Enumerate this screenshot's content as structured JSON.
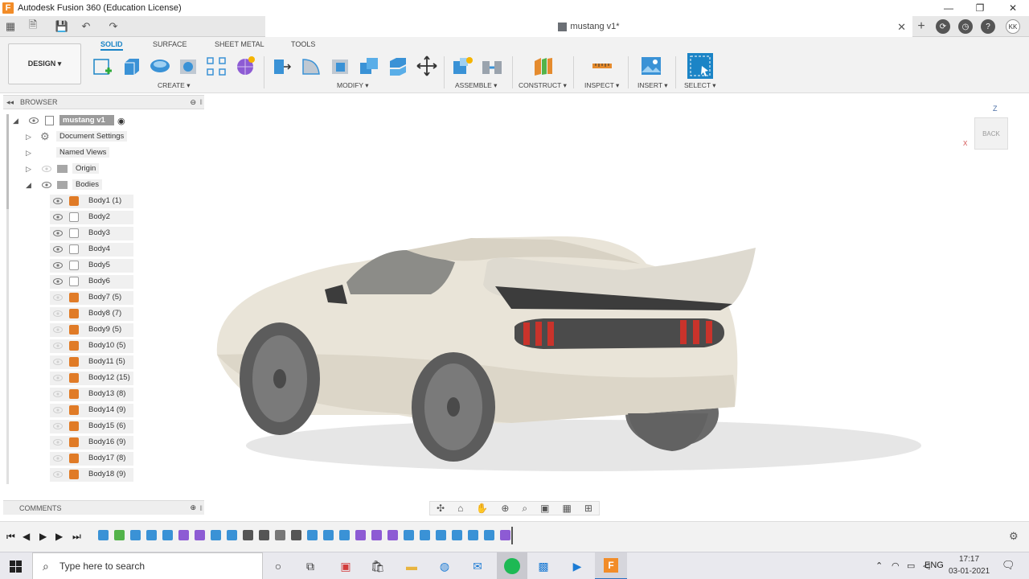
{
  "window": {
    "app_icon_letter": "F",
    "title": "Autodesk Fusion 360 (Education License)"
  },
  "document": {
    "tab_title": "mustang v1*",
    "user_initials": "KK"
  },
  "toolbar": {
    "workspace_button": "DESIGN ▾",
    "tabs": [
      "SOLID",
      "SURFACE",
      "SHEET METAL",
      "TOOLS"
    ],
    "groups": [
      "CREATE ▾",
      "MODIFY ▾",
      "ASSEMBLE ▾",
      "CONSTRUCT ▾",
      "INSPECT ▾",
      "INSERT ▾",
      "SELECT ▾"
    ]
  },
  "browser": {
    "header": "BROWSER",
    "root": "mustang v1",
    "folders": [
      "Document Settings",
      "Named Views",
      "Origin",
      "Bodies"
    ],
    "bodies": [
      "Body1 (1)",
      "Body2",
      "Body3",
      "Body4",
      "Body5",
      "Body6",
      "Body7 (5)",
      "Body8 (7)",
      "Body9 (5)",
      "Body10 (5)",
      "Body11 (5)",
      "Body12 (15)",
      "Body13 (8)",
      "Body14 (9)",
      "Body15 (6)",
      "Body16 (9)",
      "Body17 (8)",
      "Body18 (9)"
    ]
  },
  "viewcube": {
    "face": "BACK",
    "axis_z": "Z",
    "axis_x": "X"
  },
  "comments": {
    "header": "COMMENTS"
  },
  "taskbar": {
    "search_placeholder": "Type here to search",
    "lang": "ENG",
    "time": "17:17",
    "date": "03-01-2021"
  },
  "colors": {
    "accent": "#1b84c6",
    "body_orange": "#e07b27",
    "car_body": "#e9e4d8"
  }
}
